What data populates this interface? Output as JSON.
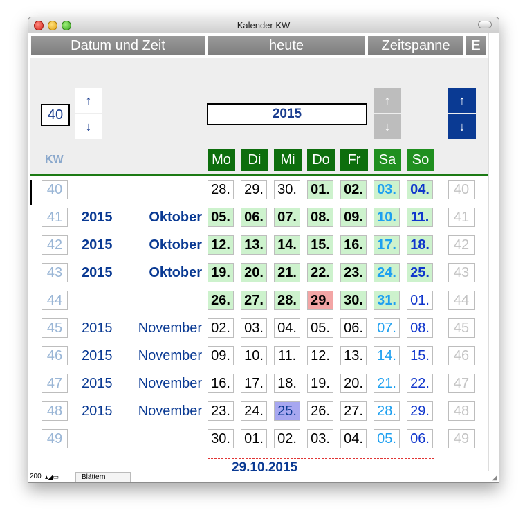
{
  "window": {
    "title": "Kalender KW"
  },
  "tabs": {
    "datetime": "Datum und Zeit",
    "today": "heute",
    "range": "Zeitspanne",
    "e": "E"
  },
  "controls": {
    "kw_value": "40",
    "year_value": "2015",
    "up_arrow": "↑",
    "down_arrow": "↓"
  },
  "header": {
    "kw_label": "KW",
    "days": [
      {
        "label": "Mo",
        "color": "#0d6e0d"
      },
      {
        "label": "Di",
        "color": "#0d6e0d"
      },
      {
        "label": "Mi",
        "color": "#0d6e0d"
      },
      {
        "label": "Do",
        "color": "#0d6e0d"
      },
      {
        "label": "Fr",
        "color": "#0d6e0d"
      },
      {
        "label": "Sa",
        "color": "#1f8f1f"
      },
      {
        "label": "So",
        "color": "#1f8f1f"
      }
    ]
  },
  "weeks": [
    {
      "kw": "40",
      "year": "",
      "month": "",
      "bold": false,
      "days": [
        {
          "d": "28.",
          "s": ""
        },
        {
          "d": "29.",
          "s": ""
        },
        {
          "d": "30.",
          "s": ""
        },
        {
          "d": "01.",
          "s": "cur"
        },
        {
          "d": "02.",
          "s": "cur"
        },
        {
          "d": "03.",
          "s": "cur sat"
        },
        {
          "d": "04.",
          "s": "cur sun"
        }
      ]
    },
    {
      "kw": "41",
      "year": "2015",
      "month": "Oktober",
      "bold": true,
      "days": [
        {
          "d": "05.",
          "s": "cur"
        },
        {
          "d": "06.",
          "s": "cur"
        },
        {
          "d": "07.",
          "s": "cur"
        },
        {
          "d": "08.",
          "s": "cur"
        },
        {
          "d": "09.",
          "s": "cur"
        },
        {
          "d": "10.",
          "s": "cur sat"
        },
        {
          "d": "11.",
          "s": "cur sun"
        }
      ]
    },
    {
      "kw": "42",
      "year": "2015",
      "month": "Oktober",
      "bold": true,
      "days": [
        {
          "d": "12.",
          "s": "cur"
        },
        {
          "d": "13.",
          "s": "cur"
        },
        {
          "d": "14.",
          "s": "cur"
        },
        {
          "d": "15.",
          "s": "cur"
        },
        {
          "d": "16.",
          "s": "cur"
        },
        {
          "d": "17.",
          "s": "cur sat"
        },
        {
          "d": "18.",
          "s": "cur sun"
        }
      ]
    },
    {
      "kw": "43",
      "year": "2015",
      "month": "Oktober",
      "bold": true,
      "days": [
        {
          "d": "19.",
          "s": "cur"
        },
        {
          "d": "20.",
          "s": "cur"
        },
        {
          "d": "21.",
          "s": "cur"
        },
        {
          "d": "22.",
          "s": "cur"
        },
        {
          "d": "23.",
          "s": "cur"
        },
        {
          "d": "24.",
          "s": "cur sat"
        },
        {
          "d": "25.",
          "s": "cur sun"
        }
      ]
    },
    {
      "kw": "44",
      "year": "",
      "month": "",
      "bold": false,
      "days": [
        {
          "d": "26.",
          "s": "cur"
        },
        {
          "d": "27.",
          "s": "cur"
        },
        {
          "d": "28.",
          "s": "cur"
        },
        {
          "d": "29.",
          "s": "today"
        },
        {
          "d": "30.",
          "s": "cur"
        },
        {
          "d": "31.",
          "s": "cur sat"
        },
        {
          "d": "01.",
          "s": "sun"
        }
      ]
    },
    {
      "kw": "45",
      "year": "2015",
      "month": "November",
      "bold": false,
      "days": [
        {
          "d": "02.",
          "s": ""
        },
        {
          "d": "03.",
          "s": ""
        },
        {
          "d": "04.",
          "s": ""
        },
        {
          "d": "05.",
          "s": ""
        },
        {
          "d": "06.",
          "s": ""
        },
        {
          "d": "07.",
          "s": "sat"
        },
        {
          "d": "08.",
          "s": "sun"
        }
      ]
    },
    {
      "kw": "46",
      "year": "2015",
      "month": "November",
      "bold": false,
      "days": [
        {
          "d": "09.",
          "s": ""
        },
        {
          "d": "10.",
          "s": ""
        },
        {
          "d": "11.",
          "s": ""
        },
        {
          "d": "12.",
          "s": ""
        },
        {
          "d": "13.",
          "s": ""
        },
        {
          "d": "14.",
          "s": "sat"
        },
        {
          "d": "15.",
          "s": "sun"
        }
      ]
    },
    {
      "kw": "47",
      "year": "2015",
      "month": "November",
      "bold": false,
      "days": [
        {
          "d": "16.",
          "s": ""
        },
        {
          "d": "17.",
          "s": ""
        },
        {
          "d": "18.",
          "s": ""
        },
        {
          "d": "19.",
          "s": ""
        },
        {
          "d": "20.",
          "s": ""
        },
        {
          "d": "21.",
          "s": "sat"
        },
        {
          "d": "22.",
          "s": "sun"
        }
      ]
    },
    {
      "kw": "48",
      "year": "2015",
      "month": "November",
      "bold": false,
      "days": [
        {
          "d": "23.",
          "s": ""
        },
        {
          "d": "24.",
          "s": ""
        },
        {
          "d": "25.",
          "s": "sel"
        },
        {
          "d": "26.",
          "s": ""
        },
        {
          "d": "27.",
          "s": ""
        },
        {
          "d": "28.",
          "s": "sat"
        },
        {
          "d": "29.",
          "s": "sun"
        }
      ]
    },
    {
      "kw": "49",
      "year": "",
      "month": "",
      "bold": false,
      "days": [
        {
          "d": "30.",
          "s": ""
        },
        {
          "d": "01.",
          "s": ""
        },
        {
          "d": "02.",
          "s": ""
        },
        {
          "d": "03.",
          "s": ""
        },
        {
          "d": "04.",
          "s": ""
        },
        {
          "d": "05.",
          "s": "sat"
        },
        {
          "d": "06.",
          "s": "sun"
        }
      ]
    }
  ],
  "selected_date": "29.10.2015",
  "status": {
    "zoom": "200",
    "icons": "▴◢▭",
    "mode": "Blättern"
  }
}
